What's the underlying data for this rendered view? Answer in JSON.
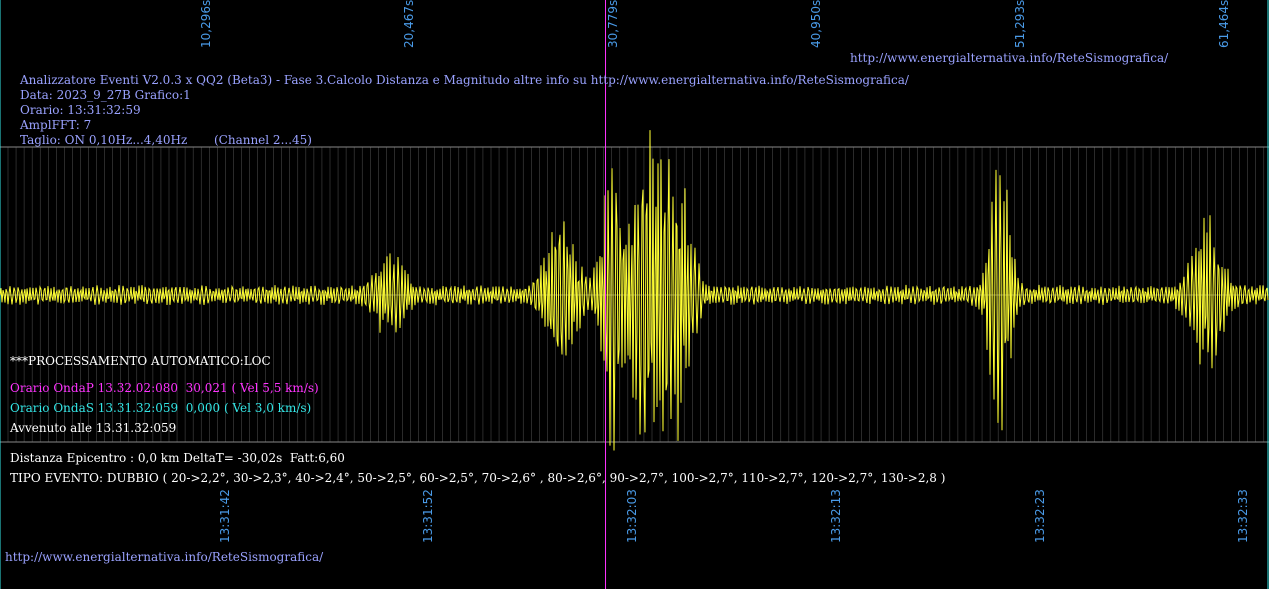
{
  "header": {
    "line1": "Analizzatore Eventi V2.0.3 x QQ2 (Beta3) - Fase 3.Calcolo Distanza e Magnitudo altre info su http://www.energialternativa.info/ReteSismografica/",
    "line2": "Data: 2023_9_27B Grafico:1",
    "line3": "Orario: 13:31:32:59",
    "line4": "AmplFFT: 7",
    "line5": "Taglio: ON 0,10Hz...4,40Hz       (Channel 2...45)"
  },
  "url_top": "http://www.energialternativa.info/ReteSismografica/",
  "url_bottom": "http://www.energialternativa.info/ReteSismografica/",
  "processing": {
    "title": "***PROCESSAMENTO AUTOMATICO:LOC",
    "onda_p": "Orario OndaP 13.32.02:080  30,021 ( Vel 5,5 km/s)",
    "onda_s": "Orario OndaS 13.31.32:059  0,000 ( Vel 3,0 km/s)",
    "avvenuto": "Avvenuto alle 13.31.32:059"
  },
  "results": {
    "distanza": "Distanza Epicentro : 0,0 km DeltaT= -30,02s  Fatt:6,60",
    "tipo_evento": "TIPO EVENTO: DUBBIO ( 20->2,2°, 30->2,3°, 40->2,4°, 50->2,5°, 60->2,5°, 70->2,6° , 80->2,6°, 90->2,7°, 100->2,7°, 110->2,7°, 120->2,7°, 130->2,8 )"
  },
  "colors": {
    "background": "#000000",
    "trace": "#ffff33",
    "p_marker": "#ff33ff",
    "grid": "#555555",
    "axis_labels": "#4a9be8",
    "header_text": "#9aa2ff"
  },
  "chart_data": {
    "type": "line",
    "title": "",
    "top_axis_seconds": [
      "10,296s",
      "20,467s",
      "30,779s",
      "40,950s",
      "51,293s",
      "61,464s"
    ],
    "bottom_axis_times": [
      "13:31:42",
      "13:31:52",
      "13:32:03",
      "13:32:13",
      "13:32:23",
      "13:32:33"
    ],
    "p_wave_marker_seconds": 30.021,
    "x_range_seconds": [
      0,
      62.4
    ],
    "y_range": [
      -1,
      1
    ],
    "grid": true,
    "series": [
      {
        "bursts": [
          {
            "t": 19.2,
            "amp": 0.25,
            "width": 0.8
          },
          {
            "t": 27.6,
            "amp": 0.45,
            "width": 0.9
          },
          {
            "t": 30.1,
            "amp": 0.85,
            "width": 0.6
          },
          {
            "t": 31.9,
            "amp": 1.0,
            "width": 1.0
          },
          {
            "t": 33.4,
            "amp": 0.7,
            "width": 0.8
          },
          {
            "t": 49.2,
            "amp": 0.85,
            "width": 0.6
          },
          {
            "t": 59.4,
            "amp": 0.45,
            "width": 0.9
          }
        ],
        "noise_amp": 0.06
      }
    ]
  }
}
